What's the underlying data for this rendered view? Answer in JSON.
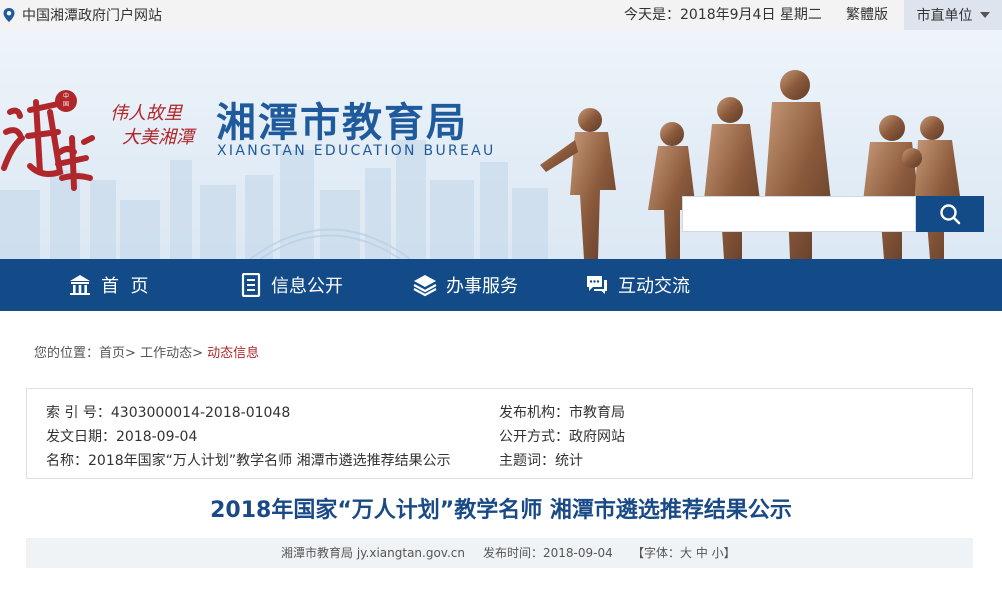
{
  "topbar": {
    "portal_link": "中国湘潭政府门户网站",
    "today": "今天是：2018年9月4日 星期二",
    "traditional": "繁體版",
    "dept_select": "市直单位"
  },
  "header": {
    "logo_text": "中国湘潭",
    "slogan_line1": "伟人故里",
    "slogan_line2": "大美湘潭",
    "title_cn": "湘潭市教育局",
    "title_en": "XIANGTAN EDUCATION BUREAU",
    "search_placeholder": ""
  },
  "nav": {
    "items": [
      {
        "label": "首  页",
        "icon": "home-icon"
      },
      {
        "label": "信息公开",
        "icon": "document-icon"
      },
      {
        "label": "办事服务",
        "icon": "layers-icon"
      },
      {
        "label": "互动交流",
        "icon": "chat-icon"
      }
    ]
  },
  "breadcrumb": {
    "prefix": "您的位置：",
    "home": "首页",
    "section": "工作动态",
    "current": "动态信息",
    "sep": ">"
  },
  "info": {
    "index_no": "索 引 号：4303000014-2018-01048",
    "publisher": "发布机构：市教育局",
    "issue_date": "发文日期：2018-09-04",
    "open_mode": "公开方式：政府网站",
    "name": "名称：2018年国家“万人计划”教学名师 湘潭市遴选推荐结果公示",
    "keywords": "主题词：统计"
  },
  "article": {
    "title": "2018年国家“万人计划”教学名师 湘潭市遴选推荐结果公示",
    "source": "湘潭市教育局 jy.xiangtan.gov.cn",
    "publish_time": "发布时间：2018-09-04",
    "font_size": "【字体：大 中 小】"
  },
  "colors": {
    "nav_bg": "#124b87",
    "title_blue": "#1f5b9c",
    "accent_red": "#b0272b"
  }
}
